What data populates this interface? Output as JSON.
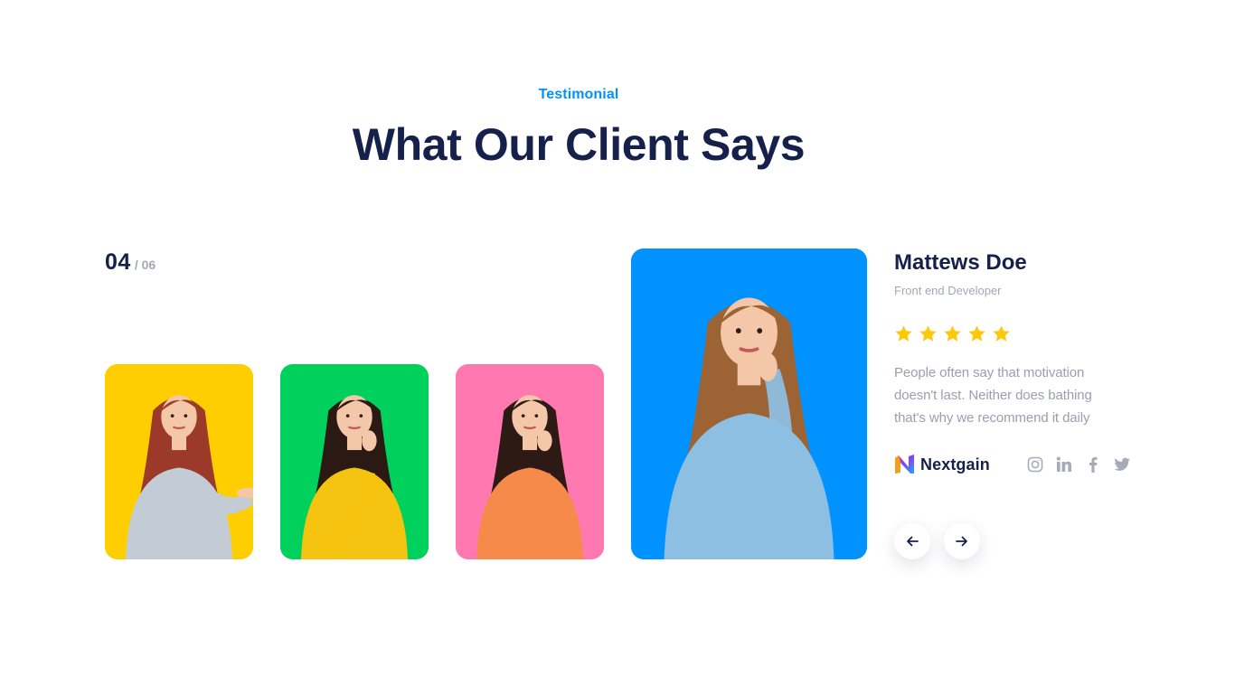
{
  "header": {
    "eyebrow": "Testimonial",
    "title": "What Our Client Says"
  },
  "counter": {
    "current": "04",
    "total": "/ 06"
  },
  "thumbnails": [
    {
      "background": "#FFCE00",
      "shirt": "#c3ccd4",
      "hair": "#9b3a28",
      "pose": "presenting"
    },
    {
      "background": "#00D15D",
      "shirt": "#f5c410",
      "hair": "#2b1a14",
      "pose": "thinking"
    },
    {
      "background": "#FF78B0",
      "shirt": "#f58a4a",
      "hair": "#2d1a14",
      "pose": "thinking"
    }
  ],
  "featured": {
    "background": "#0092FF",
    "shirt": "#8dbfe2",
    "hair": "#9c6334"
  },
  "testimonial": {
    "name": "Mattews Doe",
    "role": "Front end Developer",
    "rating": 5,
    "quote": "People often say that motivation doesn't last. Neither does bathing that's why we recommend it daily",
    "company": "Nextgain"
  },
  "social_icons": [
    "instagram-icon",
    "linkedin-icon",
    "facebook-icon",
    "twitter-icon"
  ],
  "navigation": {
    "prev_icon": "arrow-left-icon",
    "next_icon": "arrow-right-icon"
  },
  "colors": {
    "heading": "#15214A",
    "accent": "#0092FF",
    "muted": "#A3A8B6",
    "body_text": "#9A9FB0",
    "star": "#FFC80A",
    "social": "#A7ABB8"
  }
}
